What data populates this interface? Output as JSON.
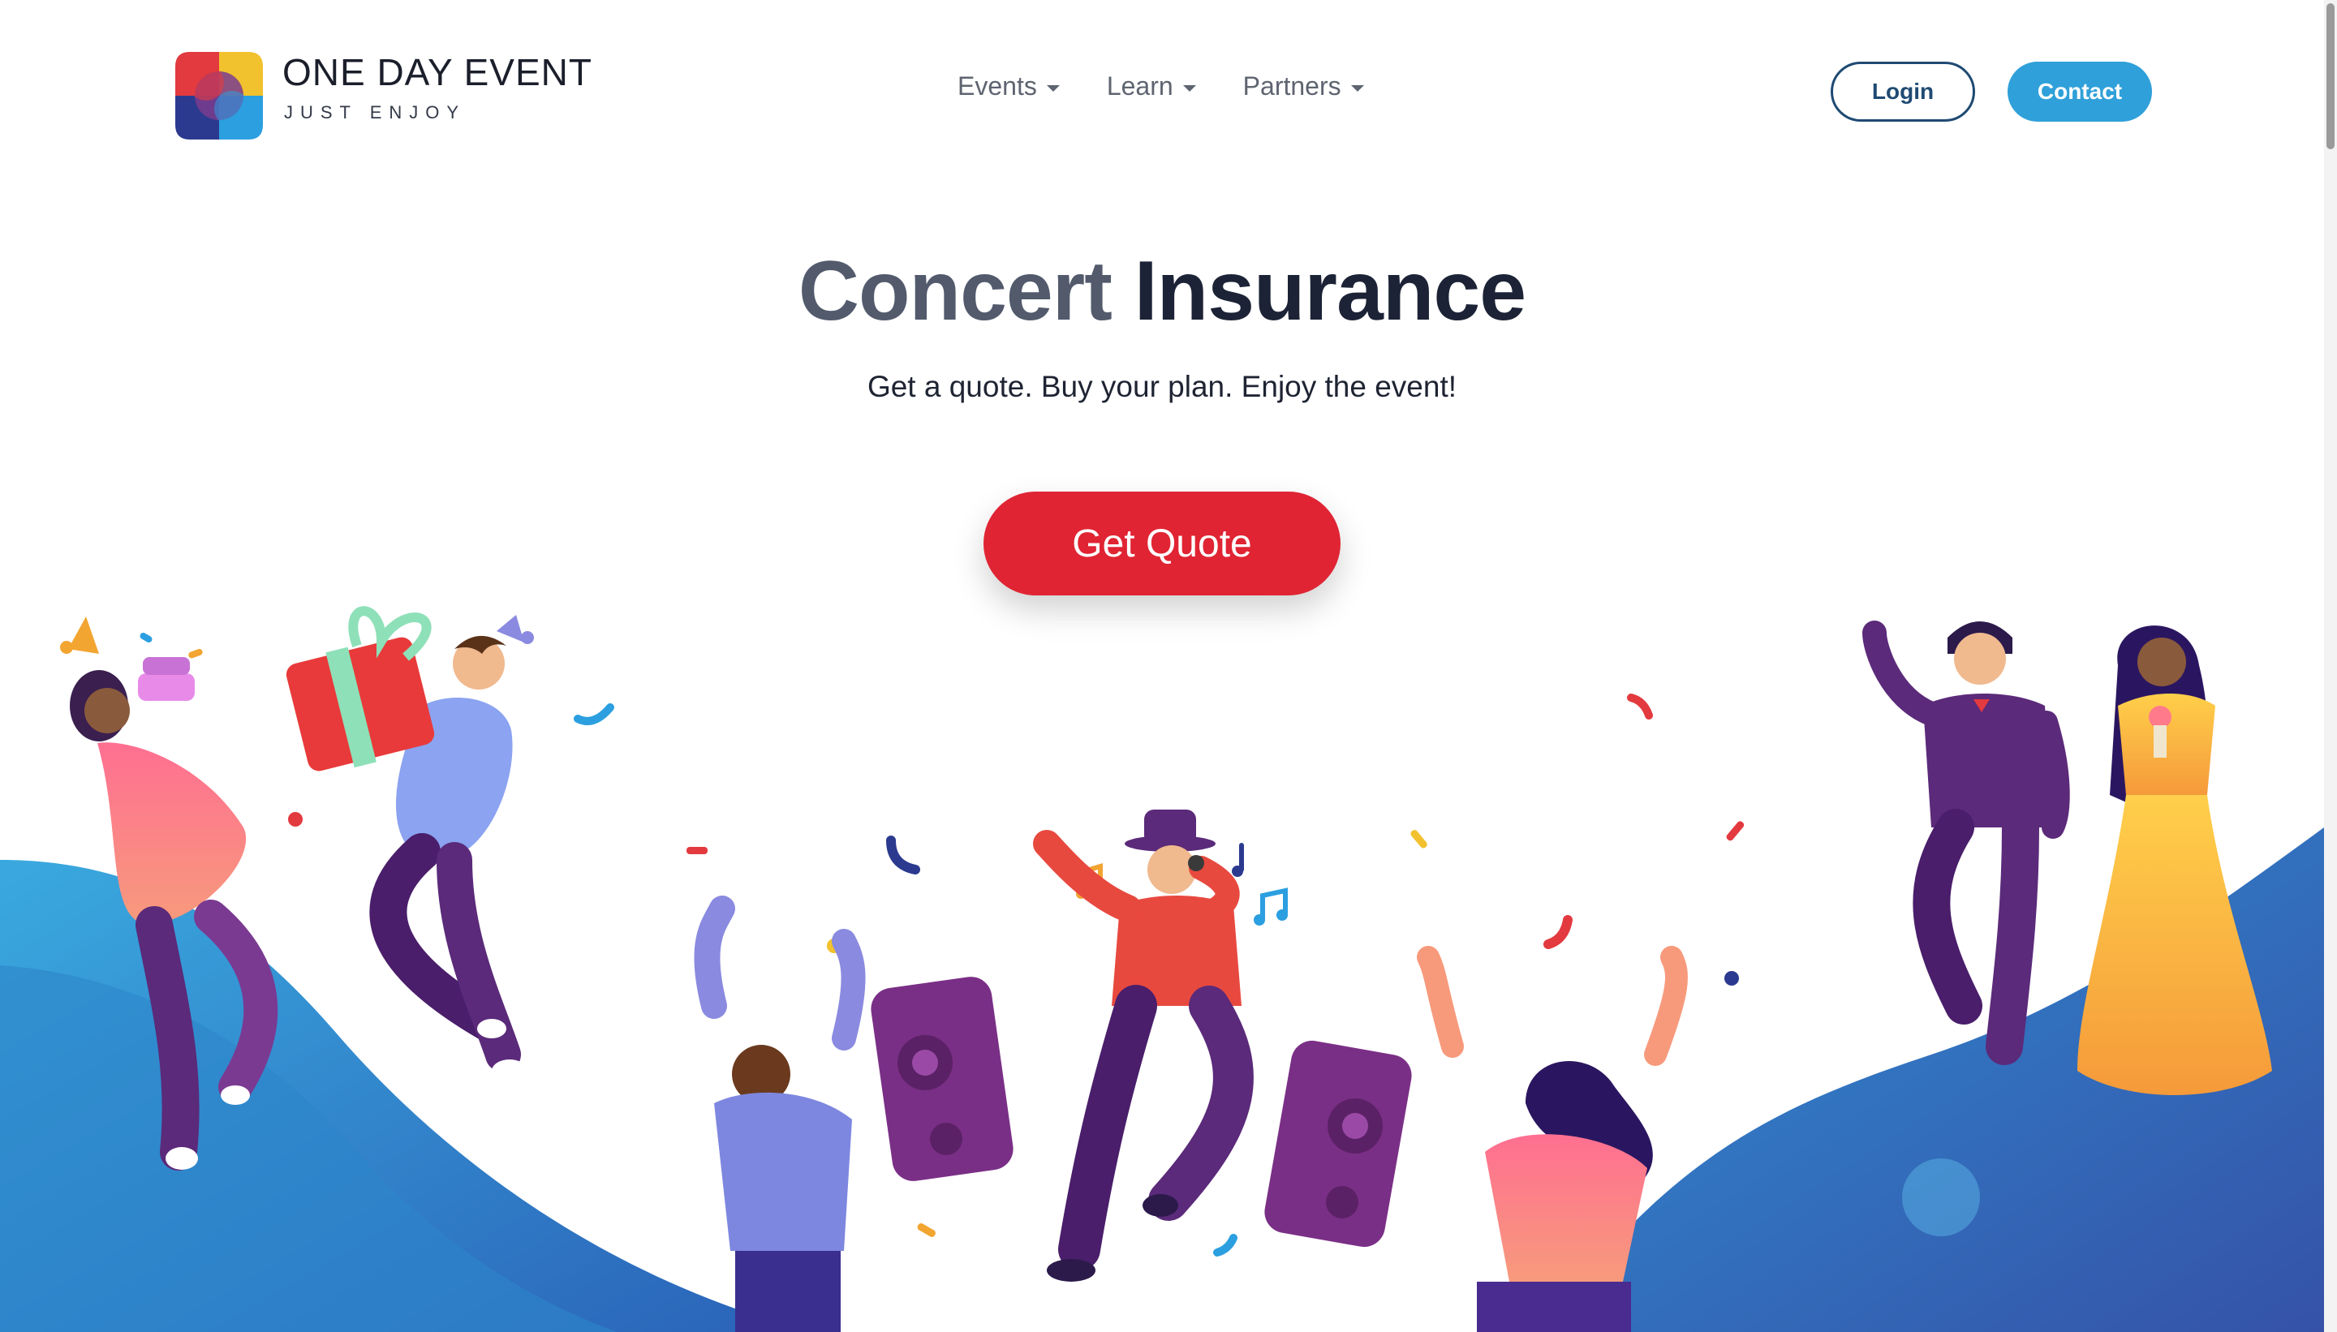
{
  "brand": {
    "name": "ONE DAY EVENT",
    "tagline": "JUST ENJOY",
    "colors": [
      "#f2c12e",
      "#e23a3f",
      "#2b9fe0",
      "#2b3a8f"
    ]
  },
  "nav": {
    "items": [
      {
        "label": "Events",
        "icon": "caret-down-icon"
      },
      {
        "label": "Learn",
        "icon": "caret-down-icon"
      },
      {
        "label": "Partners",
        "icon": "caret-down-icon"
      }
    ]
  },
  "header": {
    "login_label": "Login",
    "contact_label": "Contact"
  },
  "hero": {
    "title_part1": "Concert",
    "title_part2": "Insurance",
    "subtitle": "Get a quote. Buy your plan. Enjoy the event!",
    "cta_label": "Get Quote",
    "cta_color": "#e02433"
  },
  "illustration": {
    "scene": "party-celebration-icon",
    "wave_color": "#2e9ad8"
  }
}
